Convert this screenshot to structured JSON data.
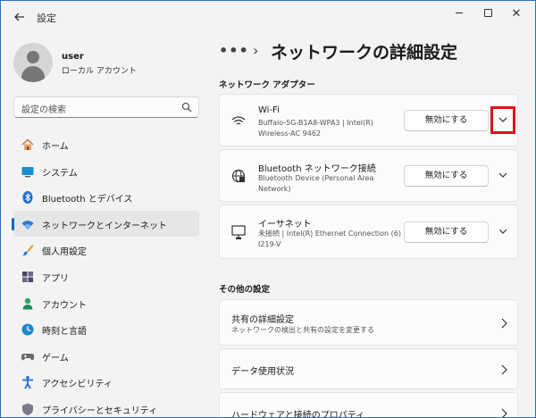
{
  "titlebar": {
    "back_icon": "arrow-left-icon",
    "title": "設定",
    "minimize": "─",
    "close": "✕"
  },
  "profile": {
    "name": "user",
    "type": "ローカル アカウント"
  },
  "search": {
    "placeholder": "設定の検索",
    "icon": "search-icon"
  },
  "sidebar": {
    "items": [
      {
        "label": "ホーム",
        "icon": "home-icon",
        "active": false
      },
      {
        "label": "システム",
        "icon": "monitor-icon",
        "active": false
      },
      {
        "label": "Bluetooth とデバイス",
        "icon": "bluetooth-icon",
        "active": false
      },
      {
        "label": "ネットワークとインターネット",
        "icon": "wifi-icon",
        "active": true
      },
      {
        "label": "個人用設定",
        "icon": "brush-icon",
        "active": false
      },
      {
        "label": "アプリ",
        "icon": "apps-icon",
        "active": false
      },
      {
        "label": "アカウント",
        "icon": "account-icon",
        "active": false
      },
      {
        "label": "時刻と言語",
        "icon": "clock-globe-icon",
        "active": false
      },
      {
        "label": "ゲーム",
        "icon": "gamepad-icon",
        "active": false
      },
      {
        "label": "アクセシビリティ",
        "icon": "accessibility-icon",
        "active": false
      },
      {
        "label": "プライバシーとセキュリティ",
        "icon": "shield-icon",
        "active": false
      }
    ]
  },
  "breadcrumb": {
    "dots": "•••",
    "separator": "›",
    "title": "ネットワークの詳細設定"
  },
  "adapters": {
    "section_title": "ネットワーク アダプター",
    "items": [
      {
        "name": "Wi-Fi",
        "desc": "Buffalo-5G-B1A8-WPA3 | Intel(R) Wireless-AC 9462",
        "button": "無効にする",
        "icon": "wifi-icon"
      },
      {
        "name": "Bluetooth ネットワーク接続",
        "desc": "Bluetooth Device (Personal Area Network)",
        "button": "無効にする",
        "icon": "globe-icon"
      },
      {
        "name": "イーサネット",
        "desc": "未接続 | Intel(R) Ethernet Connection (6) I219-V",
        "button": "無効にする",
        "icon": "ethernet-icon"
      }
    ]
  },
  "more_settings": {
    "section_title": "その他の設定",
    "items": [
      {
        "title": "共有の詳細設定",
        "desc": "ネットワークの検出と共有の設定を変更する"
      },
      {
        "title": "データ使用状況",
        "desc": ""
      },
      {
        "title": "ハードウェアと接続のプロパティ",
        "desc": ""
      }
    ]
  },
  "colors": {
    "accent": "#0067c0",
    "highlight": "#d9141b",
    "window_bg": "#f3f3f3",
    "card_bg": "#fbfbfb"
  }
}
